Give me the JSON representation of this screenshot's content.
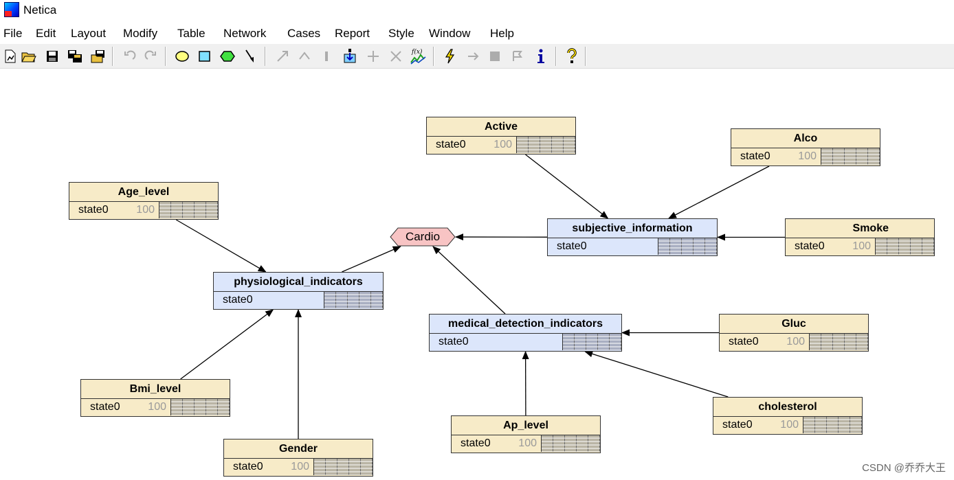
{
  "window": {
    "title": "Netica"
  },
  "menu": [
    "File",
    "Edit",
    "Layout",
    "Modify",
    "Table",
    "Network",
    "Cases",
    "Report",
    "Style",
    "Window",
    "Help"
  ],
  "toolbar": {
    "icons": [
      "new-network-icon",
      "open-icon",
      "save-icon",
      "save-all-icon",
      "open-folder-icon",
      "undo-icon",
      "redo-icon",
      "ellipse-tool-icon",
      "rectangle-tool-icon",
      "hexagon-tool-icon",
      "arrow-tool-icon",
      "compile-icon",
      "function-icon",
      "lightning-icon",
      "info-icon",
      "help-icon"
    ]
  },
  "nodes": {
    "active": {
      "title": "Active",
      "state": "state0",
      "value": "100"
    },
    "alco": {
      "title": "Alco",
      "state": "state0",
      "value": "100"
    },
    "age_level": {
      "title": "Age_level",
      "state": "state0",
      "value": "100"
    },
    "subjective_information": {
      "title": "subjective_information",
      "state": "state0"
    },
    "smoke": {
      "title": "Smoke",
      "state": "state0",
      "value": "100"
    },
    "physiological_indicators": {
      "title": "physiological_indicators",
      "state": "state0"
    },
    "medical_detection_indicators": {
      "title": "medical_detection_indicators",
      "state": "state0"
    },
    "gluc": {
      "title": "Gluc",
      "state": "state0",
      "value": "100"
    },
    "bmi_level": {
      "title": "Bmi_level",
      "state": "state0",
      "value": "100"
    },
    "cholesterol": {
      "title": "cholesterol",
      "state": "state0",
      "value": "100"
    },
    "ap_level": {
      "title": "Ap_level",
      "state": "state0",
      "value": "100"
    },
    "gender": {
      "title": "Gender",
      "state": "state0",
      "value": "100"
    },
    "cardio": {
      "title": "Cardio"
    }
  },
  "edges": [
    [
      "active",
      "subjective_information"
    ],
    [
      "alco",
      "subjective_information"
    ],
    [
      "smoke",
      "subjective_information"
    ],
    [
      "subjective_information",
      "cardio"
    ],
    [
      "age_level",
      "physiological_indicators"
    ],
    [
      "bmi_level",
      "physiological_indicators"
    ],
    [
      "gender",
      "physiological_indicators"
    ],
    [
      "physiological_indicators",
      "cardio"
    ],
    [
      "medical_detection_indicators",
      "cardio"
    ],
    [
      "gluc",
      "medical_detection_indicators"
    ],
    [
      "cholesterol",
      "medical_detection_indicators"
    ],
    [
      "ap_level",
      "medical_detection_indicators"
    ]
  ],
  "colors": {
    "node_fill": "#f7ebc8",
    "hidden_node_fill": "#dce6fb",
    "cardio_fill": "#f8c4c4",
    "edge": "#000000"
  },
  "watermark": "CSDN @乔乔大王"
}
